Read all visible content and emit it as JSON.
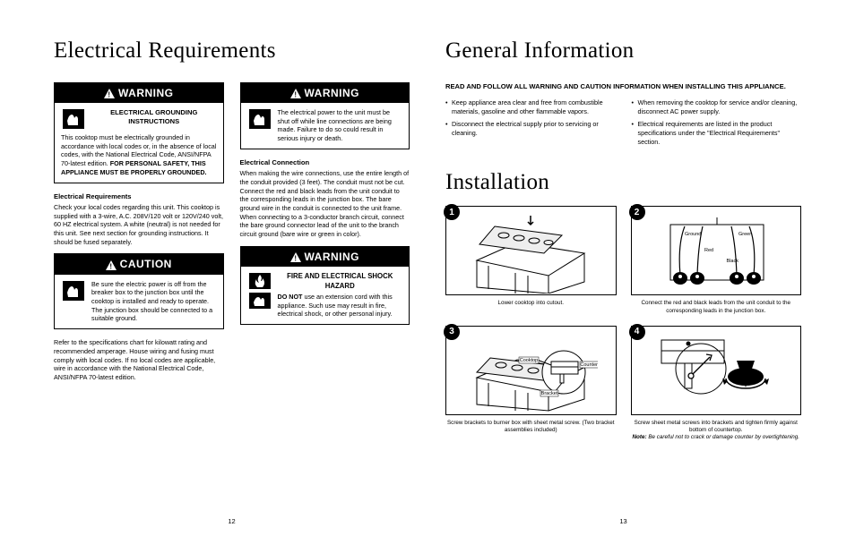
{
  "left": {
    "title": "Electrical Requirements",
    "box1": {
      "header": "WARNING",
      "subhead": "ELECTRICAL GROUNDING INSTRUCTIONS",
      "body": "This cooktop must be electrically grounded in accordance with local codes or, in the absence of local codes, with the National Electrical Code, ANSI/NFPA 70-latest edition. ",
      "bold": "FOR PERSONAL SAFETY, THIS APPLIANCE MUST BE PROPERLY GROUNDED."
    },
    "para1_head": "Electrical Requirements",
    "para1": "Check your local codes regarding this unit. This cooktop is supplied with a 3-wire, A.C. 208V/120 volt or 120V/240 volt, 60 HZ electrical system. A white (neutral) is not needed for this unit. See next section for grounding instructions. It should be fused separately.",
    "box2": {
      "header": "CAUTION",
      "body": "Be sure the electric power is off from the breaker box to the junction box until the cooktop is installed and ready to operate. The junction box should be connected to a suitable ground."
    },
    "para2": "Refer to the specifications chart for kilowatt rating and recommended amperage. House wiring and fusing must comply with local codes. If no local codes are applicable, wire in accordance with the National Electrical Code, ANSI/NFPA 70-latest edition.",
    "box3": {
      "header": "WARNING",
      "body": "The electrical power to the unit must be shut off while line connections are being made. Failure to do so could result in serious injury or death."
    },
    "para3_head": "Electrical Connection",
    "para3": "When making the wire connections, use the entire length of the conduit provided (3 feet). The conduit must not be cut. Connect the red and black leads from the unit conduit to the corresponding leads in the junction box. The bare ground wire in the conduit is connected to the unit frame. When connecting to a 3-conductor branch circuit, connect the bare ground connector lead of the unit to the branch circuit ground (bare wire or green in color).",
    "box4": {
      "header": "WARNING",
      "subhead": "FIRE AND ELECTRICAL SHOCK HAZARD",
      "lead": "DO NOT",
      "body": " use an extension cord with this appliance. Such use may result in fire, electrical shock, or other personal injury."
    },
    "pagenum": "12"
  },
  "right": {
    "title": "General Information",
    "lead": "READ AND FOLLOW ALL WARNING AND CAUTION INFORMATION WHEN INSTALLING THIS APPLIANCE.",
    "bullets_l": [
      "Keep appliance area clear and free from combustible materials, gasoline and other flammable vapors.",
      "Disconnect the electrical supply prior to servicing or cleaning."
    ],
    "bullets_r": [
      "When removing the cooktop for service and/or cleaning, disconnect AC power supply.",
      "Electrical requirements are listed in the product specifications under the \"Electrical Requirements\" section."
    ],
    "install_title": "Installation",
    "steps": [
      {
        "num": "1",
        "caption": "Lower cooktop into cutout."
      },
      {
        "num": "2",
        "caption": "Connect the red and black leads from the unit conduit to the corresponding leads in the junction box.",
        "wires": {
          "ground": "Ground",
          "green": "Green",
          "red": "Red",
          "black": "Black"
        }
      },
      {
        "num": "3",
        "caption": "Screw brackets to burner box with sheet metal screw.\n(Two bracket assemblies included)",
        "labels": {
          "cooktop": "Cooktop",
          "counter": "Countertop",
          "bracket": "Bracket"
        }
      },
      {
        "num": "4",
        "caption_plain": "Screw sheet metal screws into brackets and tighten firmly against bottom of countertop. ",
        "caption_note": "Note: Be careful not to crack or damage counter by overtightening."
      }
    ],
    "step_tab": "step",
    "pagenum": "13"
  }
}
